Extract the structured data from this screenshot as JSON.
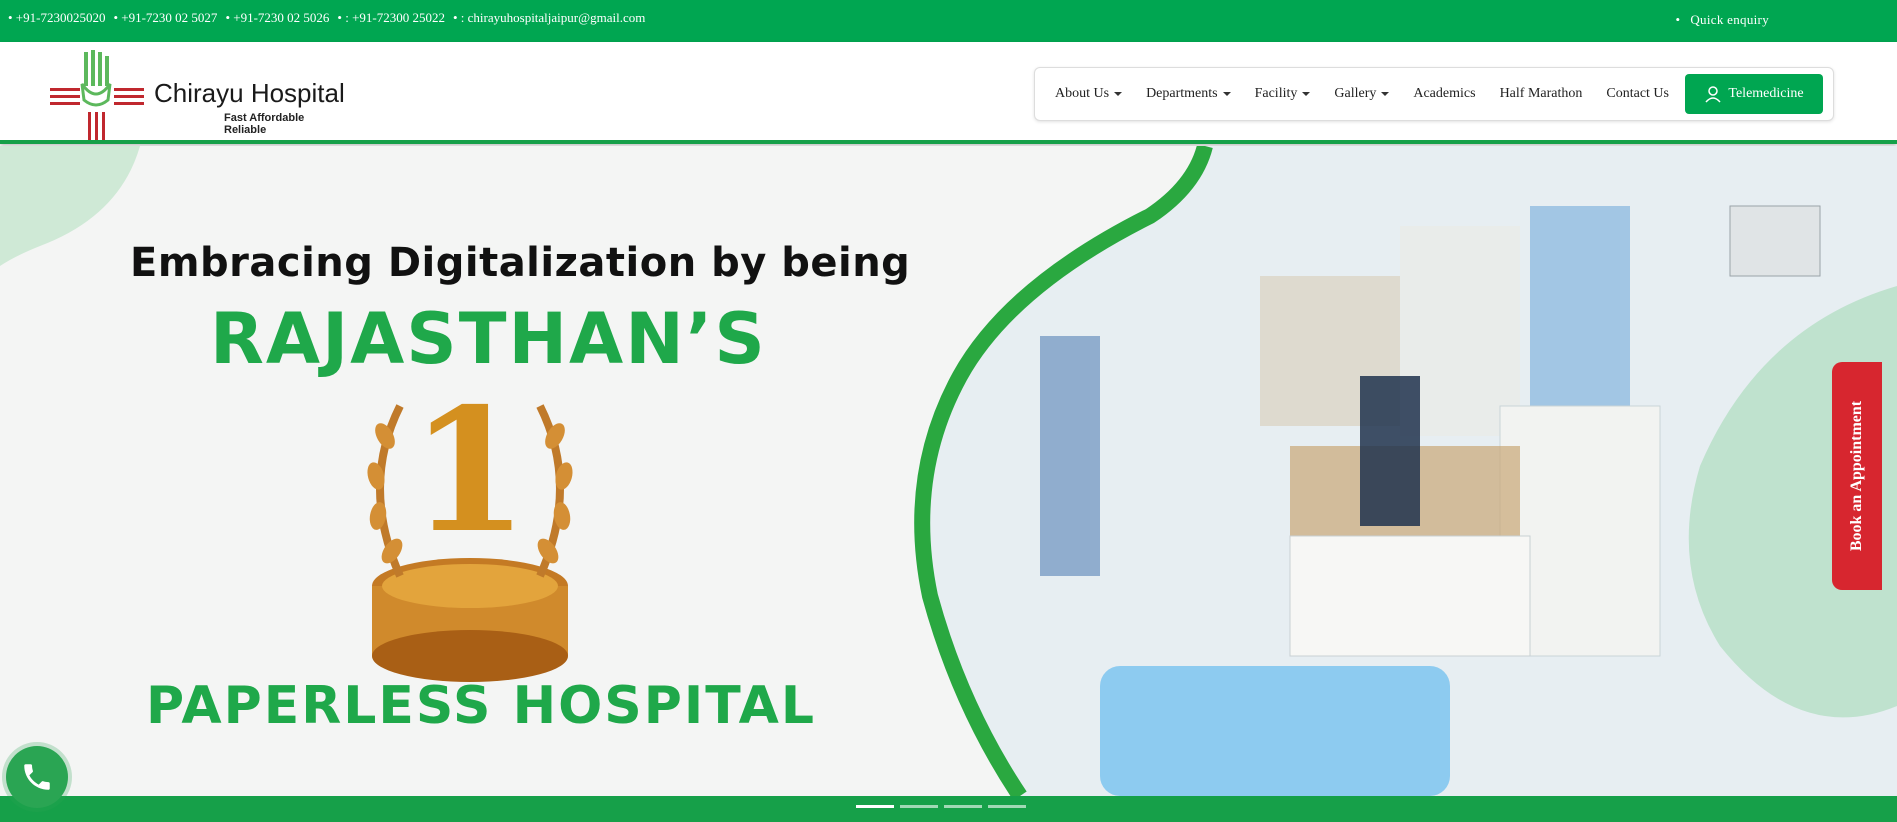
{
  "topbar": {
    "contacts": [
      "•  +91-7230025020",
      "•  +91-7230 02 5027",
      "•  +91-7230 02 5026",
      "•  : +91-72300 25022",
      "•  : chirayuhospitaljaipur@gmail.com"
    ],
    "quick_enquiry": "Quick enquiry"
  },
  "logo": {
    "brand": "Chirayu Hospital",
    "tagline": "Fast Affordable Reliable"
  },
  "nav": {
    "items": [
      {
        "label": "About Us",
        "dropdown": true
      },
      {
        "label": "Departments",
        "dropdown": true
      },
      {
        "label": "Facility",
        "dropdown": true
      },
      {
        "label": "Gallery",
        "dropdown": true
      },
      {
        "label": "Academics",
        "dropdown": false
      },
      {
        "label": "Half Marathon",
        "dropdown": false
      },
      {
        "label": "Contact Us",
        "dropdown": false
      }
    ],
    "telemedicine": "Telemedicine"
  },
  "hero": {
    "line1": "Embracing Digitalization by being",
    "line2": "RAJASTHAN’S",
    "line3": "PAPERLESS HOSPITAL",
    "award_number": "1"
  },
  "book_appointment": "Book an Appointment",
  "slider": {
    "slides": 4,
    "active": 0
  },
  "colors": {
    "brand_green": "#00a651",
    "accent_red": "#d7262f"
  }
}
